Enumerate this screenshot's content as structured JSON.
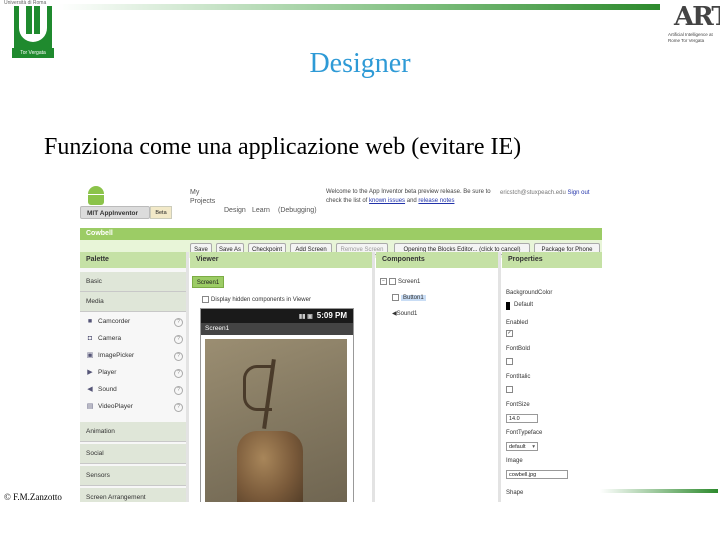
{
  "header": {
    "left_logo_caption": "Tor Vergata",
    "left_logo_small": "Università di Roma",
    "right_logo_text": "ART",
    "right_logo_subtitle": "Artificial Intelligence at Rome Tor Vergata"
  },
  "slide": {
    "title": "Designer",
    "subtitle": "Funziona come una applicazione web (evitare IE)",
    "copyright": "© F.M.Zanzotto"
  },
  "app_inventor": {
    "brand": "MIT AppInventor",
    "beta_badge": "Beta",
    "nav": {
      "my_projects": "My Projects",
      "design": "Design",
      "learn": "Learn",
      "debugging": "(Debugging)"
    },
    "welcome_text": "Welcome to the App Inventor beta preview release. Be sure to check the list of",
    "welcome_link_1": "known issues",
    "welcome_and": "and",
    "welcome_link_2": "release notes",
    "account_email": "ericstch@stuxpeach.edu",
    "sign_out": "Sign out",
    "project_name": "Cowbell",
    "toolbar": {
      "save": "Save",
      "save_as": "Save As",
      "checkpoint": "Checkpoint",
      "add_screen": "Add Screen",
      "remove_screen": "Remove Screen",
      "open_blocks": "Opening the Blocks Editor... (click to cancel)",
      "package": "Package for Phone"
    },
    "palette": {
      "header": "Palette",
      "basic": "Basic",
      "media": "Media",
      "media_items": [
        {
          "label": "Camcorder",
          "icon": "camcorder-icon",
          "glyph": "■"
        },
        {
          "label": "Camera",
          "icon": "camera-icon",
          "glyph": "◘"
        },
        {
          "label": "ImagePicker",
          "icon": "image-picker-icon",
          "glyph": "▣"
        },
        {
          "label": "Player",
          "icon": "player-icon",
          "glyph": "▶"
        },
        {
          "label": "Sound",
          "icon": "sound-icon",
          "glyph": "◀"
        },
        {
          "label": "VideoPlayer",
          "icon": "video-player-icon",
          "glyph": "▤"
        }
      ],
      "animation": "Animation",
      "social": "Social",
      "sensors": "Sensors",
      "screen_arrangement": "Screen Arrangement"
    },
    "viewer": {
      "header": "Viewer",
      "screen_button": "Screen1",
      "hidden_components": "Display hidden components in Viewer",
      "phone_time": "5:09 PM",
      "screen_title": "Screen1"
    },
    "components": {
      "header": "Components",
      "screen": "Screen1",
      "button": "Button1",
      "sound": "Sound1"
    },
    "properties": {
      "header": "Properties",
      "background_color": "BackgroundColor",
      "background_value": "Default",
      "enabled": "Enabled",
      "font_bold": "FontBold",
      "font_italic": "FontItalic",
      "font_size": "FontSize",
      "font_size_value": "14.0",
      "font_typeface": "FontTypeface",
      "font_typeface_value": "default",
      "image": "Image",
      "image_value": "cowbell.jpg",
      "shape": "Shape"
    }
  }
}
